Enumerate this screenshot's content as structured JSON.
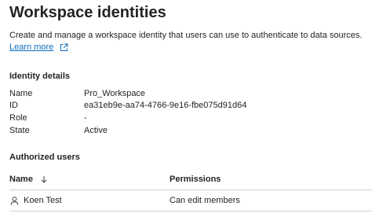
{
  "header": {
    "title": "Workspace identities",
    "description": "Create and manage a workspace identity that users can use to authenticate to data sources.",
    "learn_more": "Learn more"
  },
  "identity_details": {
    "heading": "Identity details",
    "rows": [
      {
        "key": "Name",
        "value": "Pro_Workspace"
      },
      {
        "key": "ID",
        "value": "ea31eb9e-aa74-4766-9e16-fbe075d91d64"
      },
      {
        "key": "Role",
        "value": "-"
      },
      {
        "key": "State",
        "value": "Active"
      }
    ]
  },
  "authorized_users": {
    "heading": "Authorized users",
    "columns": {
      "name": "Name",
      "permissions": "Permissions"
    },
    "rows": [
      {
        "name": "Koen Test",
        "permissions": "Can edit members"
      }
    ]
  },
  "colors": {
    "link": "#0f6cbd",
    "text": "#242424",
    "divider": "#d1d1d1"
  },
  "icons": {
    "learn_more": "open-external-icon",
    "sort": "arrow-down-icon",
    "user": "person-icon"
  }
}
